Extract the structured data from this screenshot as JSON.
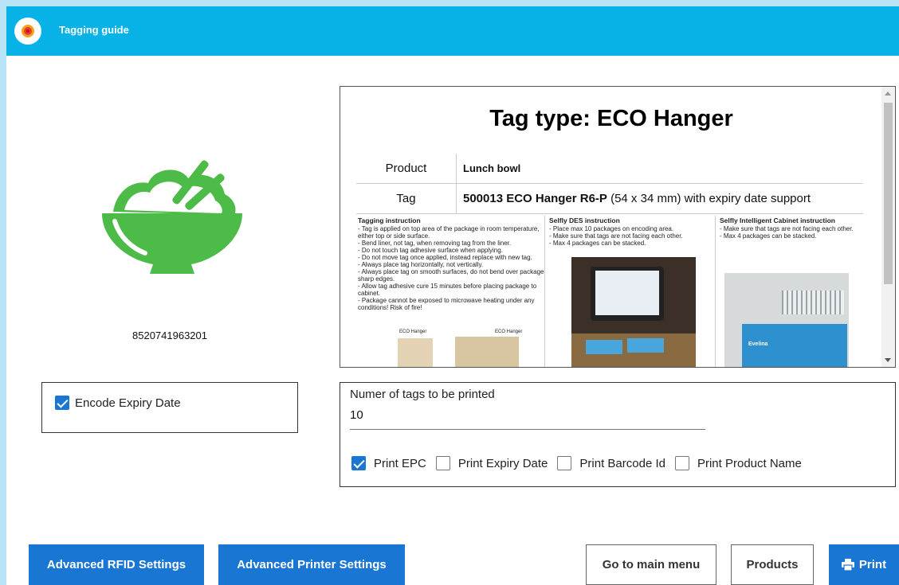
{
  "app": {
    "title": "Tagging guide"
  },
  "product": {
    "barcode": "8520741963201",
    "icon": "rice-bowl-icon"
  },
  "expiry": {
    "label": "Encode Expiry Date",
    "checked": true
  },
  "document": {
    "title": "Tag type: ECO Hanger",
    "rows": [
      {
        "key": "Product",
        "value": "Lunch bowl"
      },
      {
        "key": "Tag",
        "value_bold": "500013 ECO Hanger R6-P",
        "value_rest": " (54 x 34 mm) with expiry date support"
      }
    ],
    "columns": [
      {
        "heading": "Tagging instruction",
        "items": [
          "Tag is applied on top area of the package in room temperature, either top or side surface.",
          "Bend liner, not tag, when removing tag from the liner.",
          "Do not touch tag adhesive surface when applying.",
          "Do not move tag once applied, instead replace with new tag.",
          "Always place tag horizontally, not vertically.",
          "Always place tag on smooth surfaces, do not bend over package sharp edges.",
          "Allow tag adhesive cure 15 minutes before placing package to cabinet.",
          "Package cannot be exposed to microwave heating under any conditions! Risk of fire!"
        ],
        "diagram_labels": [
          "ECO Hanger",
          "ECO Hanger"
        ]
      },
      {
        "heading": "Selfly DES instruction",
        "items": [
          "Place max 10 packages on encoding area.",
          "Make sure that tags are not facing each other.",
          "Max 4 packages can be stacked."
        ]
      },
      {
        "heading": "Selfly Intelligent Cabinet instruction",
        "items": [
          "Make sure that tags are not facing each other.",
          "Max 4 packages can be stacked."
        ],
        "photo_label": "Evelina"
      }
    ]
  },
  "print": {
    "count_label": "Numer of tags to be printed",
    "count_value": "10",
    "options": [
      {
        "label": "Print EPC",
        "checked": true
      },
      {
        "label": "Print Expiry Date",
        "checked": false
      },
      {
        "label": "Print Barcode Id",
        "checked": false
      },
      {
        "label": "Print Product Name",
        "checked": false
      }
    ]
  },
  "buttons": {
    "rfid": "Advanced RFID Settings",
    "printer": "Advanced Printer Settings",
    "main_menu": "Go to main menu",
    "products": "Products",
    "print": "Print"
  },
  "colors": {
    "header": "#06b2e6",
    "primary": "#1976d2",
    "icon_green": "#4cbb47"
  }
}
